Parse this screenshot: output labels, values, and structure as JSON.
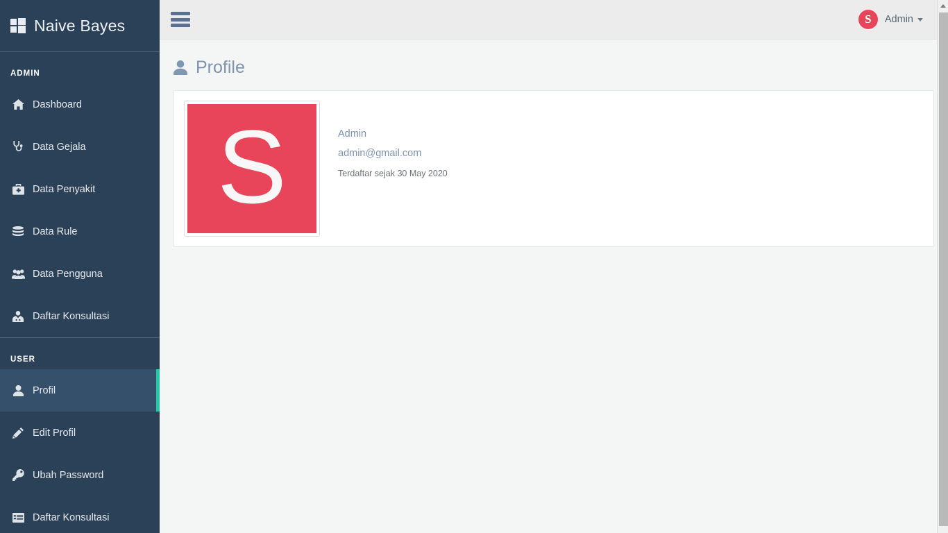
{
  "brand": {
    "title": "Naive Bayes",
    "icon": "windows-logo-icon"
  },
  "topbar": {
    "menu_toggle_icon": "hamburger-icon",
    "user": {
      "initial": "S",
      "name": "Admin",
      "caret_icon": "chevron-down-icon"
    }
  },
  "sidebar": {
    "sections": [
      {
        "label": "ADMIN",
        "items": [
          {
            "label": "Dashboard",
            "icon": "home-icon",
            "active": false
          },
          {
            "label": "Data Gejala",
            "icon": "stethoscope-icon",
            "active": false
          },
          {
            "label": "Data Penyakit",
            "icon": "medkit-icon",
            "active": false
          },
          {
            "label": "Data Rule",
            "icon": "database-icon",
            "active": false
          },
          {
            "label": "Data Pengguna",
            "icon": "users-icon",
            "active": false
          },
          {
            "label": "Daftar Konsultasi",
            "icon": "user-md-icon",
            "active": false
          }
        ]
      },
      {
        "label": "USER",
        "items": [
          {
            "label": "Profil",
            "icon": "user-icon",
            "active": true
          },
          {
            "label": "Edit Profil",
            "icon": "pencil-icon",
            "active": false
          },
          {
            "label": "Ubah Password",
            "icon": "key-icon",
            "active": false
          },
          {
            "label": "Daftar Konsultasi",
            "icon": "list-alt-icon",
            "active": false
          }
        ]
      }
    ]
  },
  "page": {
    "title": "Profile",
    "title_icon": "user-icon",
    "profile": {
      "avatar_letter": "S",
      "name": "Admin",
      "email": "admin@gmail.com",
      "registered": "Terdaftar sejak 30 May 2020"
    }
  },
  "colors": {
    "sidebar_bg": "#2b4158",
    "sidebar_active_bg": "#35506b",
    "active_marker": "#27c6a4",
    "accent_red": "#e8445a",
    "topbar_bg": "#ececec",
    "content_bg": "#f4f6f6",
    "title_text": "#7f93ab"
  }
}
